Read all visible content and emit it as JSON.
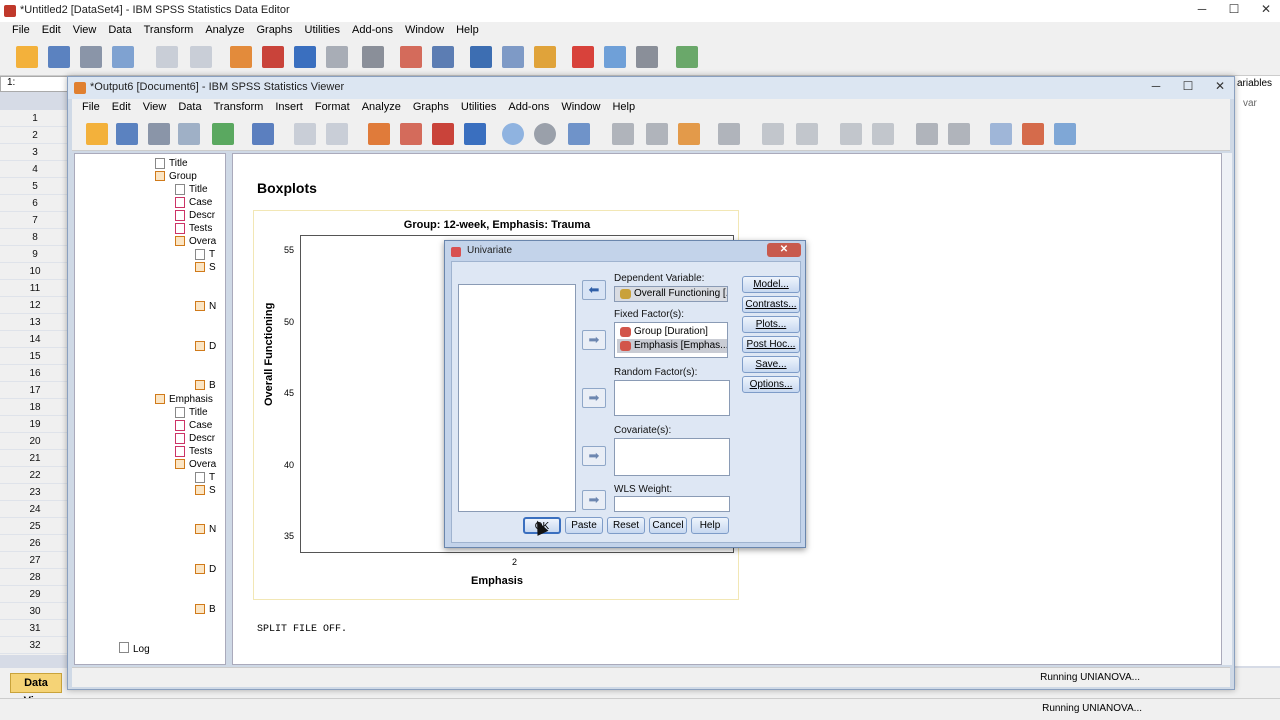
{
  "data_editor": {
    "title": "*Untitled2 [DataSet4] - IBM SPSS Statistics Data Editor",
    "menu": [
      "File",
      "Edit",
      "View",
      "Data",
      "Transform",
      "Analyze",
      "Graphs",
      "Utilities",
      "Add-ons",
      "Window",
      "Help"
    ],
    "cell_ref": "1:",
    "row_numbers": [
      "1",
      "2",
      "3",
      "4",
      "5",
      "6",
      "7",
      "8",
      "9",
      "10",
      "11",
      "12",
      "13",
      "14",
      "15",
      "16",
      "17",
      "18",
      "19",
      "20",
      "21",
      "22",
      "23",
      "24",
      "25",
      "26",
      "27",
      "28",
      "29",
      "30",
      "31",
      "32"
    ],
    "right_header": "ariables",
    "right_col": "var",
    "data_view_tab": "Data View",
    "status": "Running UNIANOVA..."
  },
  "viewer": {
    "title": "*Output6 [Document6] - IBM SPSS Statistics Viewer",
    "menu": [
      "File",
      "Edit",
      "View",
      "Data",
      "Transform",
      "Insert",
      "Format",
      "Analyze",
      "Graphs",
      "Utilities",
      "Add-ons",
      "Window",
      "Help"
    ],
    "outline": {
      "items": [
        "Title",
        "Group",
        "Title",
        "Case",
        "Descr",
        "Tests",
        "Overa",
        "T",
        "S",
        "N",
        "D",
        "B",
        "Emphasis",
        "Title",
        "Case",
        "Descr",
        "Tests",
        "Overa",
        "T",
        "S",
        "N",
        "D",
        "B",
        "Log"
      ]
    },
    "status": "Running UNIANOVA...",
    "content": {
      "heading": "Boxplots",
      "split_text": "SPLIT FILE OFF."
    }
  },
  "chart_data": {
    "type": "box",
    "title": "Group: 12-week, Emphasis: Trauma",
    "ylabel": "Overall Functioning",
    "xlabel": "Emphasis",
    "y_ticks": [
      55,
      50,
      45,
      40,
      35
    ],
    "x_ticks": [
      "2"
    ]
  },
  "dialog": {
    "title": "Univariate",
    "dependent_label": "Dependent Variable:",
    "dependent_value": "Overall Functioning [...",
    "fixed_label": "Fixed Factor(s):",
    "fixed_items": [
      "Group [Duration]",
      "Emphasis [Emphas..."
    ],
    "random_label": "Random Factor(s):",
    "covariate_label": "Covariate(s):",
    "wls_label": "WLS Weight:",
    "side_buttons": [
      "Model...",
      "Contrasts...",
      "Plots...",
      "Post Hoc...",
      "Save...",
      "Options..."
    ],
    "bottom_buttons": [
      "OK",
      "Paste",
      "Reset",
      "Cancel",
      "Help"
    ]
  }
}
